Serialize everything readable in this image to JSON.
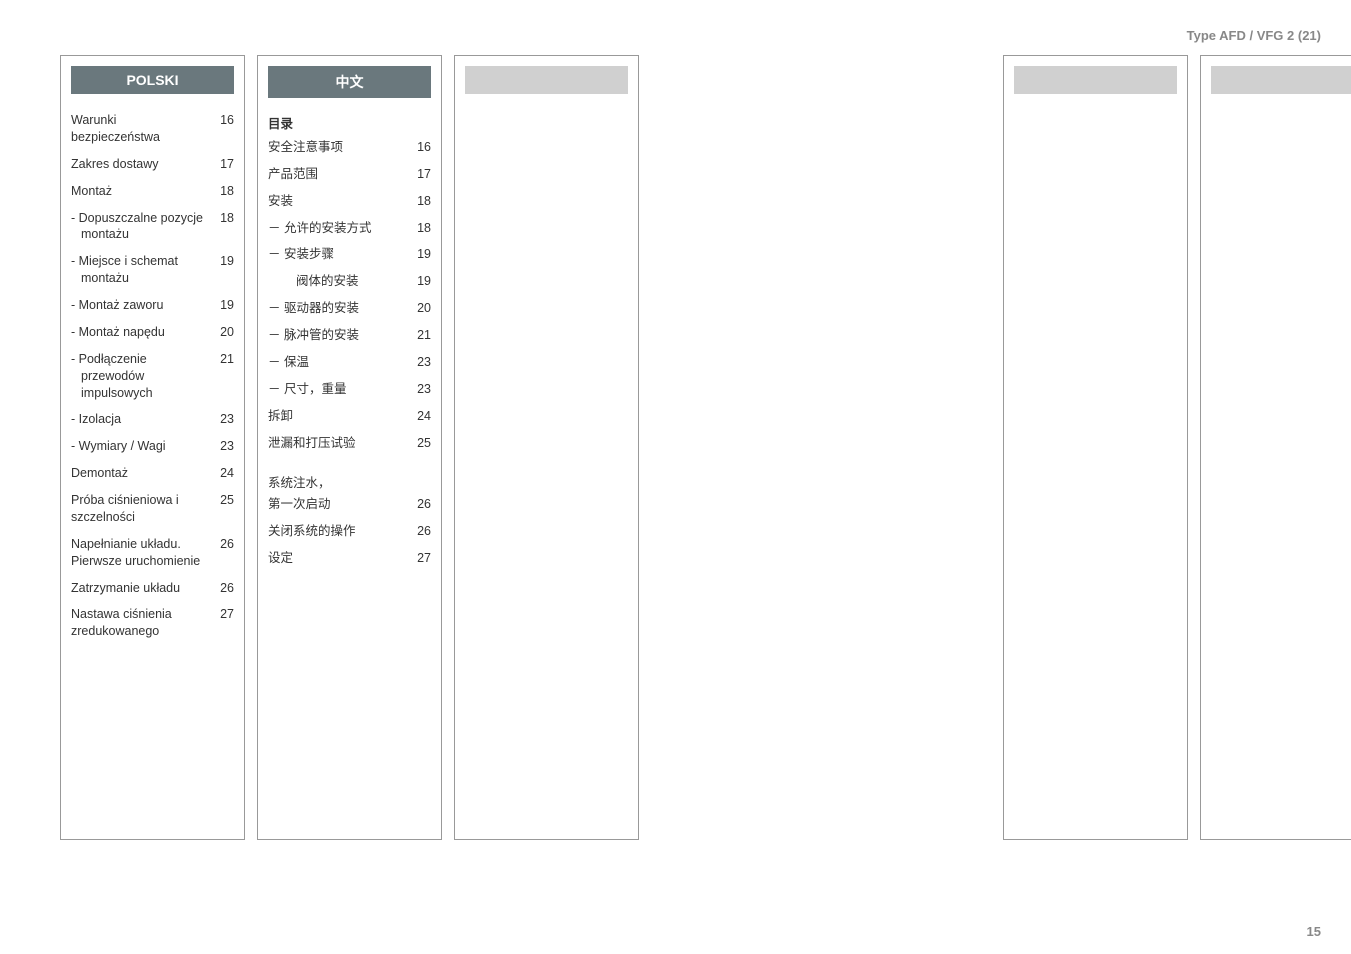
{
  "header_type": "Type AFD / VFG 2 (21)",
  "footer_page": "15",
  "columns": {
    "polski": {
      "title": "POLSKI",
      "items": [
        {
          "label": "Warunki bezpieczeństwa",
          "page": "16",
          "indent": 0
        },
        {
          "label": "Zakres dostawy",
          "page": "17",
          "indent": 0
        },
        {
          "label": "Montaż",
          "page": "18",
          "indent": 0
        },
        {
          "label": "- Dopuszczalne pozycje montażu",
          "page": "18",
          "indent": 1
        },
        {
          "label": "- Miejsce i schemat montażu",
          "page": "19",
          "indent": 1
        },
        {
          "label": "- Montaż zaworu",
          "page": "19",
          "indent": 1
        },
        {
          "label": "- Montaż napędu",
          "page": "20",
          "indent": 1
        },
        {
          "label": "- Podłączenie przewodów impulsowych",
          "page": "21",
          "indent": 1
        },
        {
          "label": "- Izolacja",
          "page": "23",
          "indent": 1
        },
        {
          "label": "- Wymiary / Wagi",
          "page": "23",
          "indent": 1
        },
        {
          "label": "Demontaż",
          "page": "24",
          "indent": 0
        },
        {
          "label": "Próba ciśnieniowa i szczelności",
          "page": "25",
          "indent": 0
        },
        {
          "label": "Napełnianie układu. Pierwsze uruchomienie",
          "page": "26",
          "indent": 0
        },
        {
          "label": "Zatrzymanie układu",
          "page": "26",
          "indent": 0
        },
        {
          "label": "Nastawa ciśnienia zredukowanego",
          "page": "27",
          "indent": 0
        }
      ]
    },
    "chinese": {
      "title": "中文",
      "heading": "目录",
      "items": [
        {
          "label": "安全注意事项",
          "page": "16",
          "indent": 0
        },
        {
          "label": "产品范围",
          "page": "17",
          "indent": 0
        },
        {
          "label": "安装",
          "page": "18",
          "indent": 0
        },
        {
          "label": "－ 允许的安装方式",
          "page": "18",
          "indent": 1
        },
        {
          "label": "－ 安装步骤",
          "page": "19",
          "indent": 1
        },
        {
          "label": "阀体的安装",
          "page": "19",
          "indent": 3
        },
        {
          "label": "－ 驱动器的安装",
          "page": "20",
          "indent": 1
        },
        {
          "label": "－ 脉冲管的安装",
          "page": "21",
          "indent": 1
        },
        {
          "label": "－ 保温",
          "page": "23",
          "indent": 1
        },
        {
          "label": "－ 尺寸，重量",
          "page": "23",
          "indent": 1
        },
        {
          "label": "拆卸",
          "page": "24",
          "indent": 0
        },
        {
          "label": "泄漏和打压试验",
          "page": "25",
          "indent": 0
        }
      ],
      "items2": [
        {
          "label": "系统注水，",
          "page": "",
          "indent": 0
        },
        {
          "label": "第一次启动",
          "page": "26",
          "indent": 0
        },
        {
          "label": "关闭系统的操作",
          "page": "26",
          "indent": 0
        },
        {
          "label": "设定",
          "page": "27",
          "indent": 0
        }
      ]
    }
  }
}
